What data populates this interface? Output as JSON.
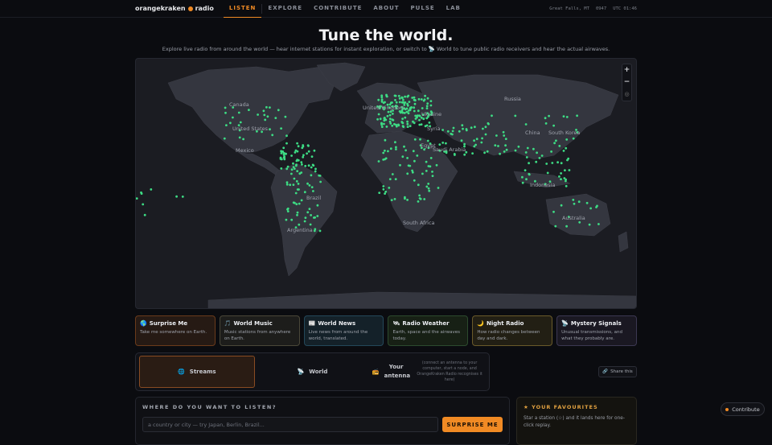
{
  "header": {
    "brand_name": "orangekraken",
    "brand_suffix": "radio",
    "nav": [
      "LISTEN",
      "EXPLORE",
      "CONTRIBUTE",
      "ABOUT",
      "PULSE",
      "LAB"
    ],
    "location": "Great Falls, MT",
    "local_time": "0947",
    "utc_time": "UTC 01:46"
  },
  "hero": {
    "title": "Tune the world.",
    "subtitle": "Explore live radio from around the world — hear internet stations for instant exploration, or switch to 📡 World to tune public radio receivers and hear the actual airwaves."
  },
  "map": {
    "labels": [
      "Canada",
      "United States",
      "Mexico",
      "Brazil",
      "Argentina",
      "United Kingdom",
      "Ukraine",
      "Russia",
      "Syria",
      "Egypt",
      "Saudi Arabia",
      "China",
      "South Korea",
      "Indonesia",
      "Australia",
      "South Africa"
    ],
    "zoom_in": "+",
    "zoom_out": "−",
    "reset": "◎",
    "station_color": "#3ddc84"
  },
  "categories": [
    {
      "icon": "🌎",
      "title": "Surprise Me",
      "desc": "Take me somewhere on Earth."
    },
    {
      "icon": "🎵",
      "title": "World Music",
      "desc": "Music stations from anywhere on Earth."
    },
    {
      "icon": "📰",
      "title": "World News",
      "desc": "Live news from around the world, translated."
    },
    {
      "icon": "🛰",
      "title": "Radio Weather",
      "desc": "Earth, space and the airwaves today."
    },
    {
      "icon": "🌙",
      "title": "Night Radio",
      "desc": "How radio changes between day and dark."
    },
    {
      "icon": "📡",
      "title": "Mystery Signals",
      "desc": "Unusual transmissions, and what they probably are."
    }
  ],
  "modes": {
    "streams": {
      "icon": "🌐",
      "label": "Streams"
    },
    "world": {
      "icon": "📡",
      "label": "World"
    },
    "antenna": {
      "icon": "📻",
      "label": "Your antenna"
    },
    "hint": "(connect an antenna to your computer, start a node, and OrangeKraken Radio recognises it here)"
  },
  "share": {
    "icon": "🔗",
    "label": "Share this"
  },
  "search": {
    "label": "WHERE DO YOU WANT TO LISTEN?",
    "placeholder": "a country or city — try Japan, Berlin, Brazil...",
    "button": "SURPRISE ME"
  },
  "favourites": {
    "label": "★ YOUR FAVOURITES",
    "desc": "Star a station (☆) and it lands here for one-click replay."
  },
  "contribute": {
    "label": "Contribute"
  }
}
